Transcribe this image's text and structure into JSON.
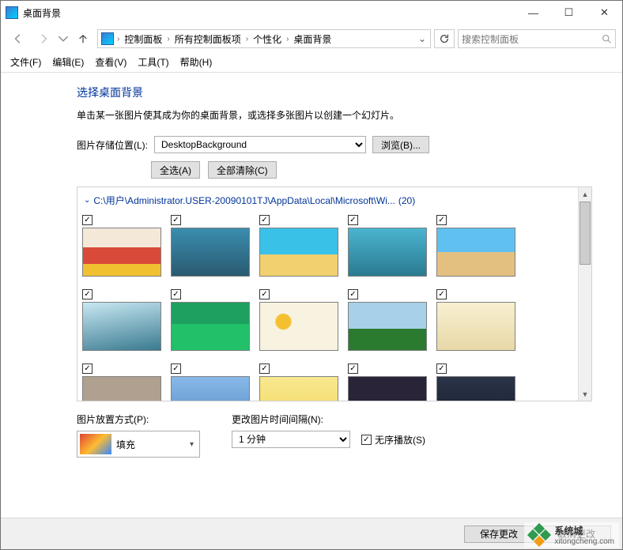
{
  "window": {
    "title": "桌面背景"
  },
  "winControls": {
    "min": "—",
    "max": "☐",
    "close": "✕"
  },
  "breadcrumb": {
    "items": [
      "控制面板",
      "所有控制面板项",
      "个性化",
      "桌面背景"
    ]
  },
  "search": {
    "placeholder": "搜索控制面板"
  },
  "menus": [
    "文件(F)",
    "编辑(E)",
    "查看(V)",
    "工具(T)",
    "帮助(H)"
  ],
  "heading": "选择桌面背景",
  "description": "单击某一张图片使其成为你的桌面背景，或选择多张图片以创建一个幻灯片。",
  "locationLabel": "图片存储位置(L):",
  "locationValue": "DesktopBackground",
  "browseBtn": "浏览(B)...",
  "selectAllBtn": "全选(A)",
  "clearAllBtn": "全部清除(C)",
  "group": {
    "path": "C:\\用户\\Administrator.USER-20090101TJ\\AppData\\Local\\Microsoft\\Wi...",
    "count": "(20)"
  },
  "thumbs": [
    {
      "cls": "t1",
      "checked": true
    },
    {
      "cls": "t2",
      "checked": true
    },
    {
      "cls": "t3",
      "checked": true
    },
    {
      "cls": "t4",
      "checked": true
    },
    {
      "cls": "t5",
      "checked": true
    },
    {
      "cls": "t6",
      "checked": true
    },
    {
      "cls": "t7",
      "checked": true
    },
    {
      "cls": "t8",
      "checked": true
    },
    {
      "cls": "t9",
      "checked": true
    },
    {
      "cls": "t10",
      "checked": true
    },
    {
      "cls": "t11",
      "checked": true
    },
    {
      "cls": "t12",
      "checked": true
    },
    {
      "cls": "t13",
      "checked": true
    },
    {
      "cls": "t14",
      "checked": true
    },
    {
      "cls": "t15",
      "checked": true
    }
  ],
  "fitLabel": "图片放置方式(P):",
  "fitValue": "填充",
  "intervalLabel": "更改图片时间间隔(N):",
  "intervalValue": "1 分钟",
  "shuffleLabel": "无序播放(S)",
  "saveBtn": "保存更改",
  "cancelBtn": "取消更改",
  "watermark": {
    "brand": "系统城",
    "url": "xitongcheng.com"
  }
}
